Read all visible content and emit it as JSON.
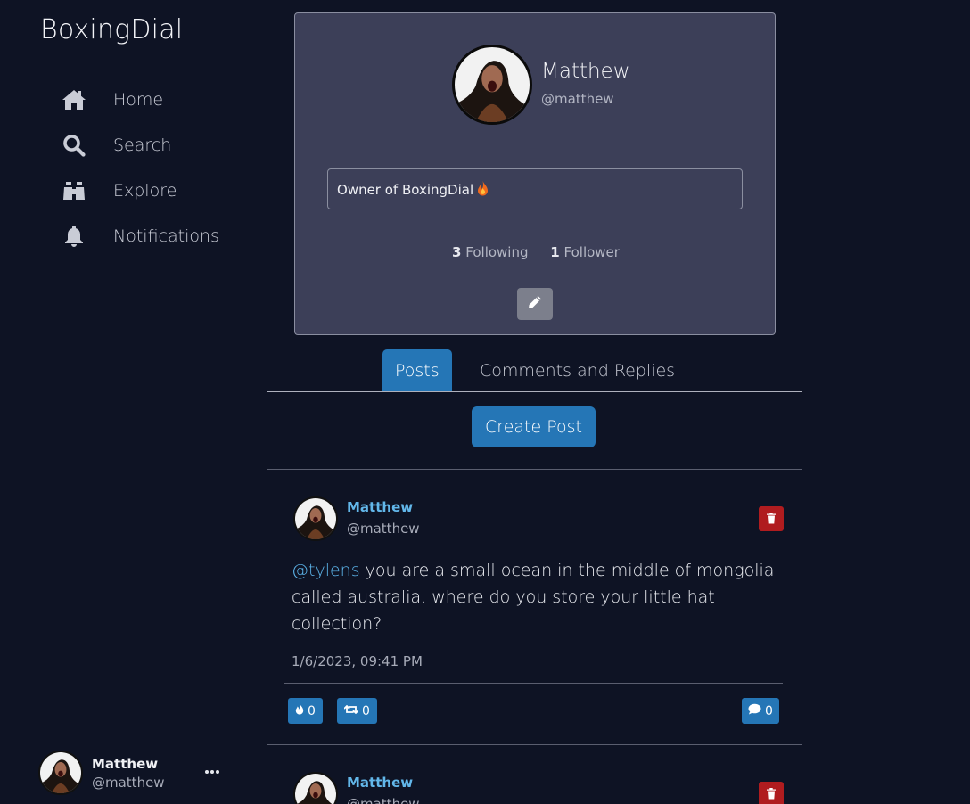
{
  "app": {
    "brand": "BoxingDial"
  },
  "sidebar": {
    "items": [
      {
        "label": "Home",
        "icon": "home-icon"
      },
      {
        "label": "Search",
        "icon": "search-icon"
      },
      {
        "label": "Explore",
        "icon": "binoculars-icon"
      },
      {
        "label": "Notifications",
        "icon": "bell-icon"
      }
    ],
    "account": {
      "name": "Matthew",
      "handle": "@matthew",
      "menu_icon": "ellipsis-icon"
    }
  },
  "profile": {
    "name": "Matthew",
    "handle": "@matthew",
    "bio": "Owner of BoxingDial",
    "bio_emoji": "flame-icon",
    "following_count": "3",
    "following_label": "Following",
    "followers_count": "1",
    "followers_label": "Follower",
    "edit_icon": "pencil-icon"
  },
  "tabs": [
    {
      "label": "Posts",
      "active": true
    },
    {
      "label": "Comments and Replies",
      "active": false
    }
  ],
  "create_post_label": "Create Post",
  "posts": [
    {
      "name": "Matthew",
      "handle": "@matthew",
      "mention": "@tylens",
      "text": " you are a small ocean in the middle of mongolia called australia. where do you store your little hat collection?",
      "timestamp": "1/6/2023, 09:41 PM",
      "likes": "0",
      "reposts": "0",
      "comments": "0"
    },
    {
      "name": "Matthew",
      "handle": "@matthew"
    }
  ],
  "colors": {
    "background": "#0e1324",
    "card": "#3c3f58",
    "accent": "#2576b6",
    "danger": "#b01c1f",
    "link": "#62b7ea"
  }
}
